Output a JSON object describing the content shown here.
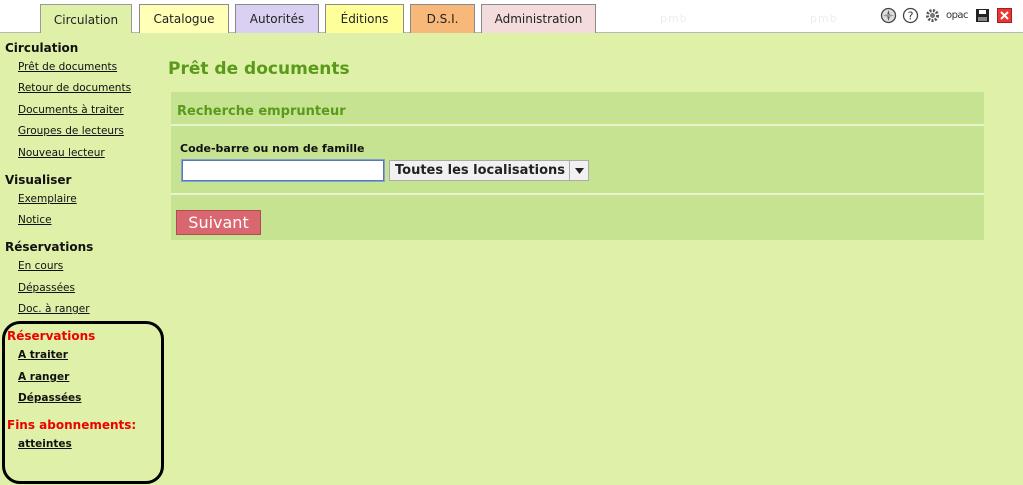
{
  "tabs": [
    {
      "label": "Circulation",
      "color": "#dff0a9"
    },
    {
      "label": "Catalogue",
      "color": "#ffffb5"
    },
    {
      "label": "Autorités",
      "color": "#d9d0f2"
    },
    {
      "label": "Éditions",
      "color": "#ffff99"
    },
    {
      "label": "D.S.I.",
      "color": "#f8b87a"
    },
    {
      "label": "Administration",
      "color": "#f5dcdc"
    }
  ],
  "watermarks": [
    "pmb",
    "pmb"
  ],
  "toolbar": {
    "opac_label": "opac",
    "icons": [
      "compass-icon",
      "help-icon",
      "settings-icon",
      "opac-icon",
      "save-icon",
      "close-icon"
    ]
  },
  "sidebar": {
    "circulation": {
      "title": "Circulation",
      "items": [
        "Prêt de documents",
        "Retour de documents",
        "Documents à traiter",
        "Groupes de lecteurs",
        "Nouveau lecteur"
      ]
    },
    "visualiser": {
      "title": "Visualiser",
      "items": [
        "Exemplaire",
        "Notice"
      ]
    },
    "reservations": {
      "title": "Réservations",
      "items": [
        "En cours",
        "Dépassées",
        "Doc. à ranger"
      ]
    },
    "alerts": {
      "reservations_title": "Réservations",
      "reservations_items": [
        "A traiter",
        "A ranger",
        "Dépassées"
      ],
      "fins_title": "Fins abonnements:",
      "fins_items": [
        "atteintes"
      ]
    }
  },
  "main": {
    "title": "Prêt de documents",
    "panel_title": "Recherche emprunteur",
    "field_label": "Code-barre ou nom de famille",
    "input_value": "",
    "select_value": "Toutes les localisations",
    "submit_label": "Suivant"
  },
  "colors": {
    "page_bg": "#dff0a9",
    "panel_bg": "#c6e392",
    "title_green": "#5a9a1a",
    "alert_red": "#ee0000",
    "button_bg": "#d9676f"
  }
}
